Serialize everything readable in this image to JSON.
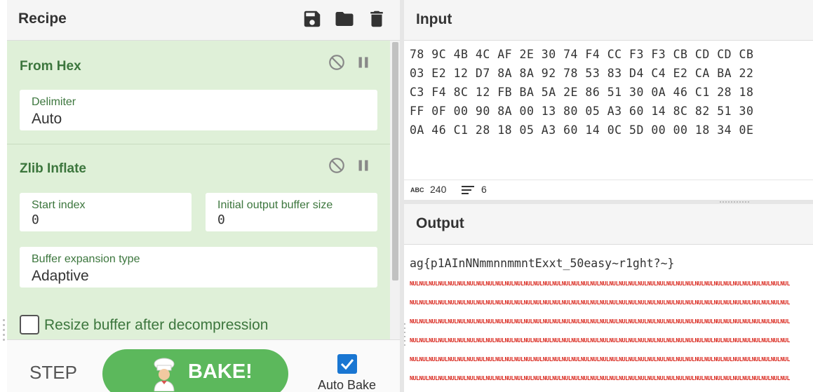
{
  "recipe": {
    "title": "Recipe",
    "header_icons": [
      "save-icon",
      "folder-icon",
      "trash-icon"
    ],
    "operations": [
      {
        "title": "From Hex",
        "fields": [
          {
            "label": "Delimiter",
            "value": "Auto"
          }
        ]
      },
      {
        "title": "Zlib Inflate",
        "fields": [
          {
            "label": "Start index",
            "value": "0"
          },
          {
            "label": "Initial output buffer size",
            "value": "0"
          },
          {
            "label": "Buffer expansion type",
            "value": "Adaptive"
          }
        ],
        "checkbox": {
          "label": "Resize buffer after decompression",
          "checked": false
        }
      }
    ],
    "controls": {
      "step_label": "STEP",
      "bake_label": "BAKE!",
      "autobake_label": "Auto Bake",
      "autobake_checked": true
    }
  },
  "input": {
    "title": "Input",
    "lines": [
      "78 9C 4B 4C AF 2E 30 74 F4 CC F3 F3 CB CD CD CB",
      "03 E2 12 D7 8A 8A 92 78 53 83 D4 C4 E2 CA BA 22",
      "C3 F4 8C 12 FB BA 5A 2E 86 51 30 0A 46 C1 28 18",
      "FF 0F 00 90 8A 00 13 80 05 A3 60 14 8C 82 51 30",
      "0A 46 C1 28 18 05 A3 60 14 0C 5D 00 00 18 34 0E"
    ],
    "status": {
      "abc_label": "ABC",
      "length": "240",
      "lines": "6"
    }
  },
  "output": {
    "title": "Output",
    "text": "ag{p1AInNNmmnnmmntExxt_50easy~r1ght?~}",
    "nul_token": "NUL",
    "nul_rows": 6
  },
  "colors": {
    "recipe_op_bg": "#dff0d8",
    "op_title": "#3c763d",
    "bake_button": "#5cb85c",
    "autobake_check": "#1976d2",
    "nul_text": "#d9261c"
  }
}
